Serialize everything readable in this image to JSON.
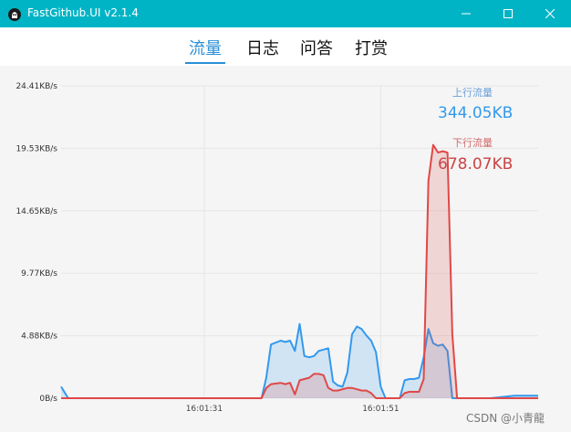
{
  "window": {
    "title": "FastGithub.UI v2.1.4",
    "accent_color": "#00b4c6",
    "icons": [
      "app-icon",
      "minimize-icon",
      "maximize-icon",
      "close-icon"
    ]
  },
  "tabs": [
    {
      "label": "流量",
      "active": true
    },
    {
      "label": "日志",
      "active": false
    },
    {
      "label": "问答",
      "active": false
    },
    {
      "label": "打赏",
      "active": false
    }
  ],
  "legend": {
    "upload_label": "上行流量",
    "upload_value": "344.05KB",
    "upload_color": "#3399ee",
    "download_label": "下行流量",
    "download_value": "678.07KB",
    "download_color": "#e04848"
  },
  "watermark": "CSDN @小青龍",
  "chart_data": {
    "type": "area",
    "y_tick_labels": [
      "0B/s",
      "4.88KB/s",
      "9.77KB/s",
      "14.65KB/s",
      "19.53KB/s",
      "24.41KB/s"
    ],
    "ylim": [
      0,
      24.41
    ],
    "y_unit": "KB/s",
    "x_tick_labels": [
      "16:01:31",
      "16:01:51"
    ],
    "grid": true,
    "legend_position": "top-right",
    "series": [
      {
        "name": "上行流量",
        "color": "#3399ee",
        "x": [
          0,
          1,
          1.5,
          2,
          5,
          10,
          15,
          20,
          25,
          30,
          35,
          38,
          40,
          42,
          43,
          44,
          46,
          47,
          48,
          49,
          50,
          51,
          52,
          53,
          54,
          55,
          56,
          57,
          58,
          59,
          60,
          61,
          62,
          63,
          64,
          65,
          66,
          67,
          68,
          69,
          70,
          71,
          72,
          73,
          74,
          75,
          76,
          77,
          78,
          79,
          80,
          81,
          82,
          83,
          84,
          85,
          86,
          87,
          88,
          89,
          90,
          95,
          100
        ],
        "values": [
          0.9,
          0.3,
          0,
          0,
          0,
          0,
          0,
          0,
          0,
          0,
          0,
          0,
          0,
          0,
          1.6,
          4.2,
          4.5,
          4.4,
          4.5,
          3.7,
          5.8,
          3.3,
          3.2,
          3.3,
          3.7,
          3.8,
          3.9,
          1.3,
          1.0,
          0.9,
          2.0,
          5.0,
          5.6,
          5.4,
          4.9,
          4.5,
          3.6,
          0.9,
          0,
          0,
          0,
          0,
          1.4,
          1.5,
          1.5,
          1.6,
          3.2,
          5.4,
          4.3,
          4.1,
          4.2,
          3.7,
          0,
          0,
          0,
          0,
          0,
          0,
          0,
          0,
          0,
          0.2,
          0.2
        ]
      },
      {
        "name": "下行流量",
        "color": "#e04848",
        "x": [
          0,
          10,
          20,
          30,
          35,
          38,
          40,
          42,
          43,
          44,
          46,
          47,
          48,
          49,
          50,
          51,
          52,
          53,
          54,
          55,
          56,
          57,
          58,
          59,
          60,
          61,
          62,
          63,
          64,
          65,
          66,
          67,
          68,
          69,
          70,
          71,
          72,
          73,
          74,
          75,
          76,
          77,
          78,
          79,
          80,
          81,
          82,
          83,
          84,
          85,
          86,
          87,
          88,
          89,
          90,
          95,
          100
        ],
        "values": [
          0,
          0,
          0,
          0,
          0,
          0,
          0,
          0,
          0.8,
          1.1,
          1.2,
          1.1,
          1.2,
          0.3,
          1.4,
          1.5,
          1.6,
          1.9,
          1.9,
          1.8,
          0.8,
          0.6,
          0.6,
          0.7,
          0.8,
          0.8,
          0.7,
          0.6,
          0.6,
          0.4,
          0,
          0,
          0,
          0,
          0,
          0,
          0.4,
          0.5,
          0.5,
          0.5,
          1.5,
          17.0,
          19.8,
          19.2,
          19.3,
          19.2,
          5.0,
          0,
          0,
          0,
          0,
          0,
          0,
          0,
          0,
          0,
          0
        ]
      }
    ]
  }
}
